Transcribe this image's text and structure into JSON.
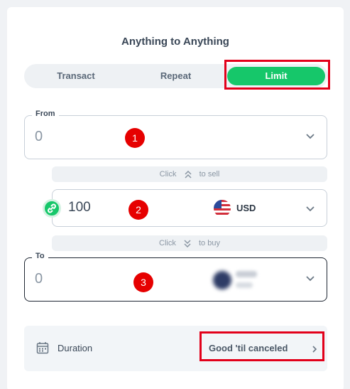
{
  "title": "Anything to Anything",
  "tabs": {
    "transact": "Transact",
    "repeat": "Repeat",
    "limit": "Limit",
    "active": "Limit",
    "active_color": "#16c76a"
  },
  "from": {
    "label": "From",
    "value": "0"
  },
  "sell_hint": {
    "prefix": "Click",
    "icon": "double-chevron-up-icon",
    "suffix": "to sell"
  },
  "amount": {
    "value": "100",
    "currency": "USD",
    "currency_icon": "us-flag-icon",
    "link_icon": "link-icon",
    "link_color": "#16c76a"
  },
  "buy_hint": {
    "prefix": "Click",
    "icon": "double-chevron-down-icon",
    "suffix": "to buy"
  },
  "to": {
    "label": "To",
    "value": "0"
  },
  "duration": {
    "icon": "calendar-icon",
    "label": "Duration",
    "value": "Good 'til canceled",
    "arrow_icon": "chevron-right-icon"
  },
  "annotations": {
    "marker_1": "1",
    "marker_2": "2",
    "marker_3": "3",
    "highlight_color": "#e2001a"
  }
}
